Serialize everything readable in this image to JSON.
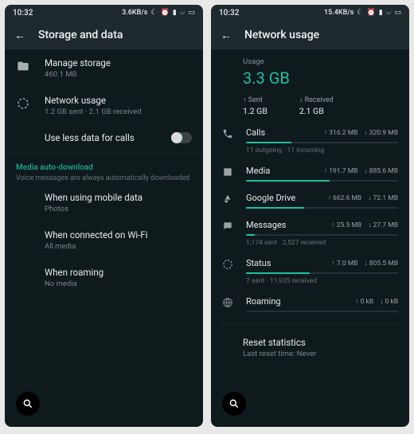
{
  "left": {
    "status": {
      "time": "10:32",
      "speed": "3.6KB/s"
    },
    "appbar": {
      "title": "Storage and data"
    },
    "manage": {
      "label": "Manage storage",
      "sub": "460.1 MB"
    },
    "network": {
      "label": "Network usage",
      "sub": "1.2 GB sent · 2.1 GB received"
    },
    "less_data": {
      "label": "Use less data for calls"
    },
    "media_header": {
      "title": "Media auto-download",
      "sub": "Voice messages are always automatically downloaded"
    },
    "mobile": {
      "label": "When using mobile data",
      "sub": "Photos"
    },
    "wifi": {
      "label": "When connected on Wi-Fi",
      "sub": "All media"
    },
    "roaming": {
      "label": "When roaming",
      "sub": "No media"
    }
  },
  "right": {
    "status": {
      "time": "10:32",
      "speed": "15.4KB/s"
    },
    "appbar": {
      "title": "Network usage"
    },
    "usage": {
      "label": "Usage",
      "total": "3.3 GB",
      "sent_label": "Sent",
      "sent_val": "1.2 GB",
      "recv_label": "Received",
      "recv_val": "2.1 GB"
    },
    "items": {
      "calls": {
        "name": "Calls",
        "up": "↑ 316.2 MB",
        "down": "↓ 320.9 MB",
        "bar": 30,
        "sub": "11 outgoing · 11 incoming"
      },
      "media": {
        "name": "Media",
        "up": "↑ 191.7 MB",
        "down": "↓ 885.6 MB",
        "bar": 55,
        "sub": ""
      },
      "drive": {
        "name": "Google Drive",
        "up": "↑ 662.6 MB",
        "down": "↓ 72.1 MB",
        "bar": 38,
        "sub": ""
      },
      "msgs": {
        "name": "Messages",
        "up": "↑ 25.5 MB",
        "down": "↓ 27.7 MB",
        "bar": 6,
        "sub": "1,174 sent · 2,527 received"
      },
      "status": {
        "name": "Status",
        "up": "↑ 7.0 MB",
        "down": "↓ 805.5 MB",
        "bar": 42,
        "sub": "7 sent · 11,935 received"
      },
      "roaming": {
        "name": "Roaming",
        "up": "↑ 0 kB",
        "down": "↓ 0 kB",
        "bar": 0,
        "sub": ""
      }
    },
    "reset": {
      "label": "Reset statistics",
      "sub": "Last reset time: Never"
    }
  }
}
